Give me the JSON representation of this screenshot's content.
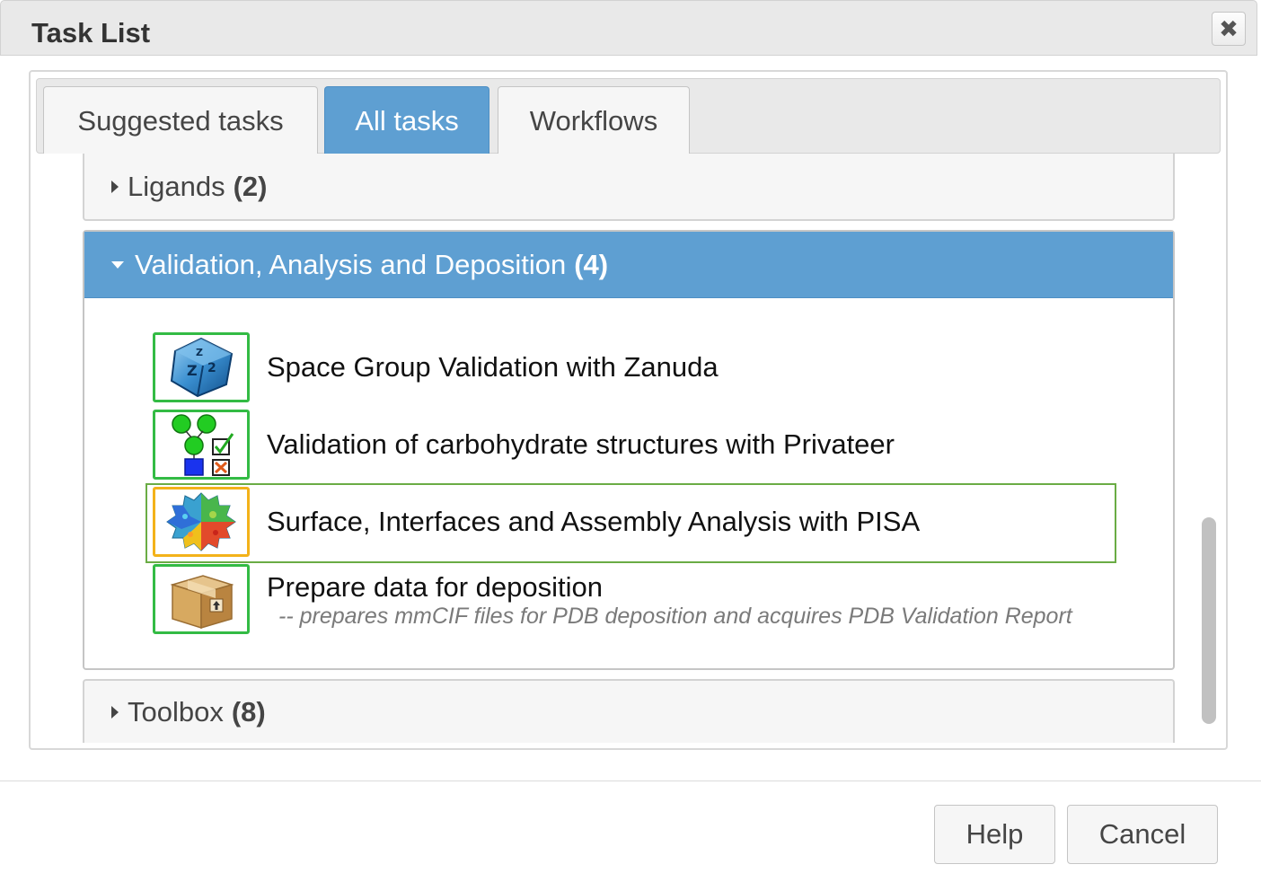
{
  "window": {
    "title": "Task List",
    "close_glyph": "✖"
  },
  "tabs": [
    {
      "label": "Suggested tasks",
      "active": false
    },
    {
      "label": "All tasks",
      "active": true
    },
    {
      "label": "Workflows",
      "active": false
    }
  ],
  "sections": {
    "ligands": {
      "label": "Ligands",
      "count": "(2)",
      "expanded": false
    },
    "validation": {
      "label": "Validation, Analysis and Deposition",
      "count": "(4)",
      "expanded": true,
      "tasks": [
        {
          "label": "Space Group Validation with Zanuda",
          "icon": "zanuda-dice-icon"
        },
        {
          "label": "Validation of carbohydrate structures with Privateer",
          "icon": "privateer-glycan-icon"
        },
        {
          "label": "Surface, Interfaces and Assembly Analysis with PISA",
          "icon": "pisa-surface-icon",
          "selected": true
        },
        {
          "label": "Prepare data for deposition",
          "subtitle": "-- prepares mmCIF files for PDB deposition and acquires PDB Validation Report",
          "icon": "deposition-box-icon"
        }
      ]
    },
    "toolbox": {
      "label": "Toolbox",
      "count": "(8)",
      "expanded": false
    }
  },
  "footer": {
    "help_label": "Help",
    "cancel_label": "Cancel"
  },
  "colors": {
    "accent": "#5e9fd2",
    "icon_border": "#33bb44",
    "selected_icon_border": "#f3b21a",
    "row_highlight": "#6aac45"
  }
}
